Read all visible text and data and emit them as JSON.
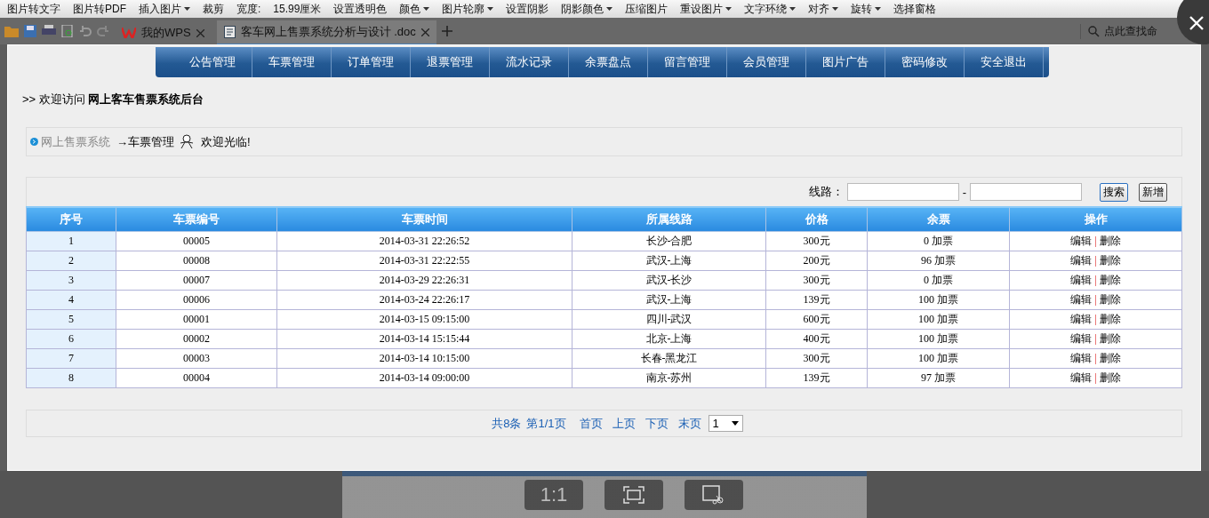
{
  "app_toolbar": {
    "items": [
      {
        "label": "图片转文字",
        "dropdown": false
      },
      {
        "label": "图片转PDF",
        "dropdown": false
      },
      {
        "label": "插入图片",
        "dropdown": true
      },
      {
        "label": "裁剪",
        "dropdown": false
      },
      {
        "label": "宽度:",
        "dropdown": false
      },
      {
        "label": "15.99厘米",
        "dropdown": false
      },
      {
        "label": "设置透明色",
        "dropdown": false
      },
      {
        "label": "颜色",
        "dropdown": true
      },
      {
        "label": "图片轮廓",
        "dropdown": true
      },
      {
        "label": "设置阴影",
        "dropdown": false
      },
      {
        "label": "阴影颜色",
        "dropdown": true
      },
      {
        "label": "压缩图片",
        "dropdown": false
      },
      {
        "label": "重设图片",
        "dropdown": true
      },
      {
        "label": "文字环绕",
        "dropdown": true
      },
      {
        "label": "对齐",
        "dropdown": true
      },
      {
        "label": "旋转",
        "dropdown": true
      },
      {
        "label": "选择窗格",
        "dropdown": false
      }
    ]
  },
  "document_tabs": [
    {
      "label": "我的WPS",
      "selected": false
    },
    {
      "label": "客车网上售票系统分析与设计 .doc",
      "selected": true
    }
  ],
  "command_search": {
    "placeholder": "点此查找命"
  },
  "page": {
    "nav": [
      "公告管理",
      "车票管理",
      "订单管理",
      "退票管理",
      "流水记录",
      "余票盘点",
      "留言管理",
      "会员管理",
      "图片广告",
      "密码修改",
      "安全退出"
    ],
    "welcome": {
      "prefix": ">> 欢迎访问",
      "title": "网上客车售票系统后台"
    },
    "breadcrumb": {
      "root": "网上售票系统",
      "current": "→车票管理",
      "greeting": "欢迎光临!"
    },
    "search": {
      "label": "线路：",
      "separator": "-",
      "buttons": [
        "搜索",
        "新增"
      ]
    },
    "table": {
      "columns": [
        "序号",
        "车票编号",
        "车票时间",
        "所属线路",
        "价格",
        "余票",
        "操作"
      ],
      "rows": [
        {
          "cells": [
            "1",
            "00005",
            "2014-03-31 22:26:52",
            "长沙-合肥",
            "300元"
          ],
          "stock": "0",
          "add": "加票",
          "edit": "编辑",
          "separator": "|",
          "delete": "删除"
        },
        {
          "cells": [
            "2",
            "00008",
            "2014-03-31 22:22:55",
            "武汉-上海",
            "200元"
          ],
          "stock": "96",
          "add": "加票",
          "edit": "编辑",
          "separator": "|",
          "delete": "删除"
        },
        {
          "cells": [
            "3",
            "00007",
            "2014-03-29 22:26:31",
            "武汉-长沙",
            "300元"
          ],
          "stock": "0",
          "add": "加票",
          "edit": "编辑",
          "separator": "|",
          "delete": "删除"
        },
        {
          "cells": [
            "4",
            "00006",
            "2014-03-24 22:26:17",
            "武汉-上海",
            "139元"
          ],
          "stock": "100",
          "add": "加票",
          "edit": "编辑",
          "separator": "|",
          "delete": "删除"
        },
        {
          "cells": [
            "5",
            "00001",
            "2014-03-15 09:15:00",
            "四川-武汉",
            "600元"
          ],
          "stock": "100",
          "add": "加票",
          "edit": "编辑",
          "separator": "|",
          "delete": "删除"
        },
        {
          "cells": [
            "6",
            "00002",
            "2014-03-14 15:15:44",
            "北京-上海",
            "400元"
          ],
          "stock": "100",
          "add": "加票",
          "edit": "编辑",
          "separator": "|",
          "delete": "删除"
        },
        {
          "cells": [
            "7",
            "00003",
            "2014-03-14 10:15:00",
            "长春-黑龙江",
            "300元"
          ],
          "stock": "100",
          "add": "加票",
          "edit": "编辑",
          "separator": "|",
          "delete": "删除"
        },
        {
          "cells": [
            "8",
            "00004",
            "2014-03-14 09:00:00",
            "南京-苏州",
            "139元"
          ],
          "stock": "97",
          "add": "加票",
          "edit": "编辑",
          "separator": "|",
          "delete": "删除"
        }
      ]
    },
    "pager": {
      "summary": "共8条",
      "page": "第1/1页",
      "links": [
        "首页",
        "上页",
        "下页",
        "末页"
      ],
      "page_select": "1"
    }
  },
  "viewer": {
    "zoom_label": "1:1"
  }
}
